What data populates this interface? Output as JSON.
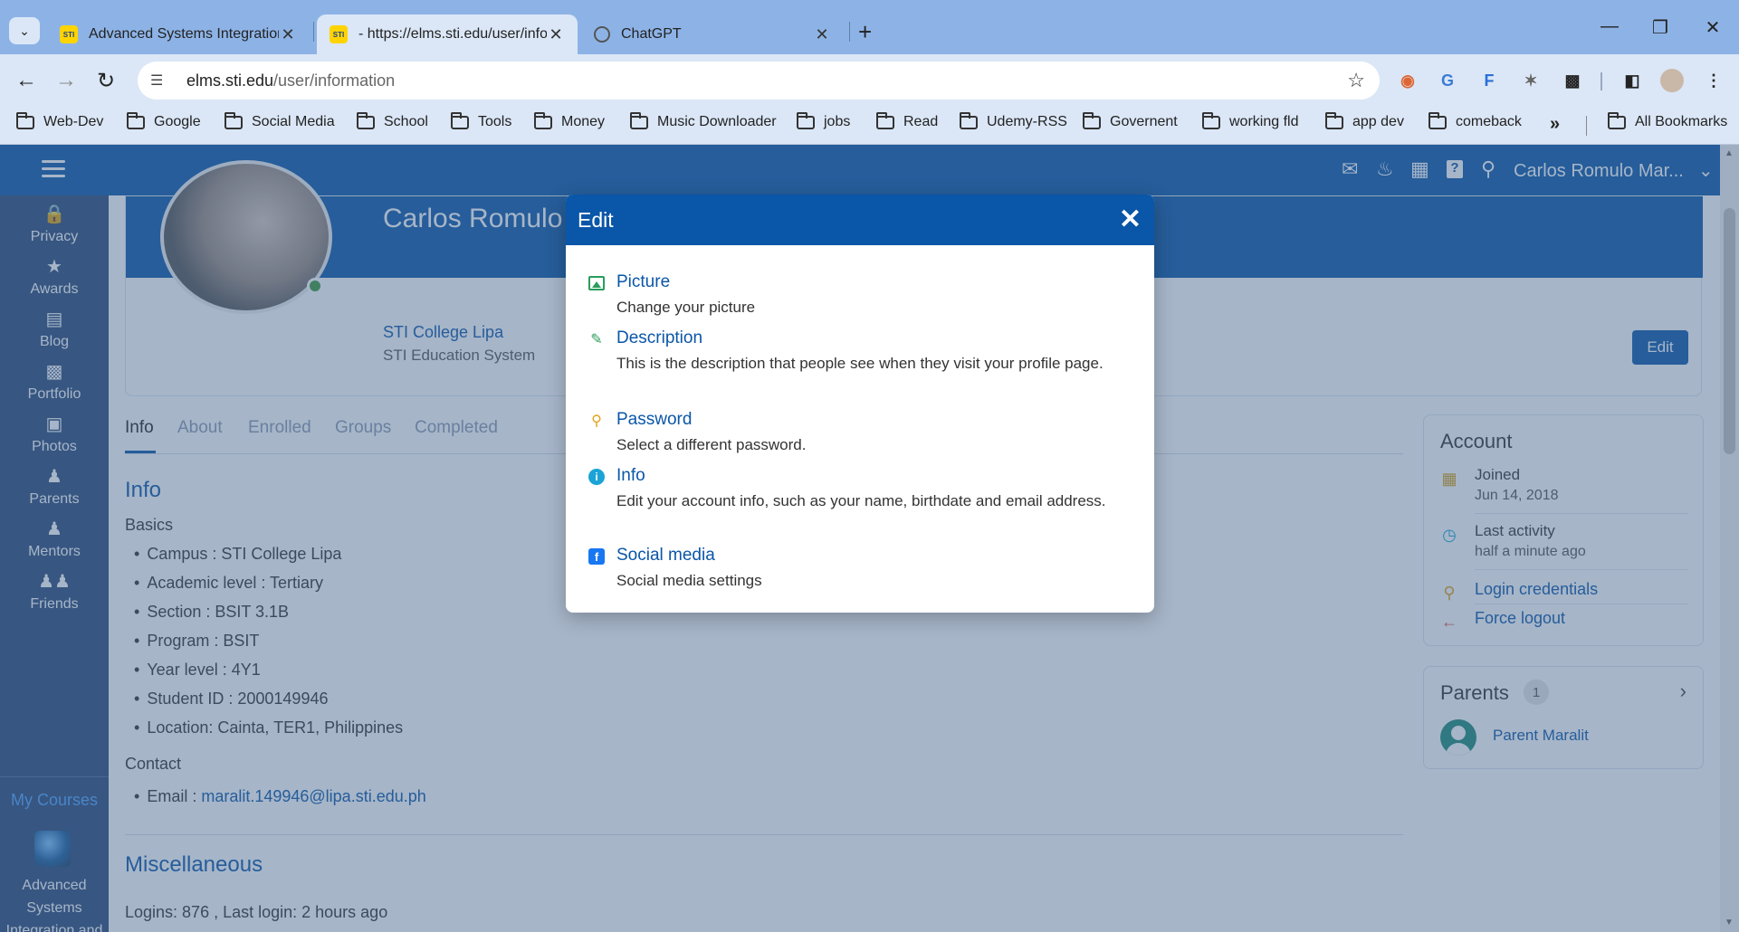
{
  "browser": {
    "tabs": [
      {
        "title": "Advanced Systems Integration",
        "favicon": "sti-icon",
        "active": false
      },
      {
        "title": "- https://elms.sti.edu/user/info",
        "favicon": "sti-icon",
        "active": true
      },
      {
        "title": "ChatGPT",
        "favicon": "chatgpt-icon",
        "active": false
      }
    ],
    "url_host": "elms.sti.edu",
    "url_path": "/user/information",
    "bookmarks": [
      "Web-Dev",
      "Google",
      "Social Media",
      "School",
      "Tools",
      "Money",
      "Music Downloader",
      "jobs",
      "Read",
      "Udemy-RSS",
      "Governent",
      "working fld",
      "app dev",
      "comeback"
    ],
    "all_bookmarks": "All Bookmarks"
  },
  "topnav": {
    "user_name": "Carlos Romulo Mar..."
  },
  "sidebar": {
    "items": [
      "Privacy",
      "Awards",
      "Blog",
      "Portfolio",
      "Photos",
      "Parents",
      "Mentors",
      "Friends"
    ],
    "my_courses": "My Courses",
    "course_name": "Advanced Systems Integration and Architecture -"
  },
  "profile": {
    "name": "Carlos Romulo M",
    "school": "STI College Lipa",
    "system": "STI Education System",
    "edit_label": "Edit"
  },
  "tabs": [
    "Info",
    "About",
    "Enrolled",
    "Groups",
    "Completed"
  ],
  "info": {
    "title": "Info",
    "basics_title": "Basics",
    "basics": [
      "Campus : STI College Lipa",
      "Academic level : Tertiary",
      "Section : BSIT 3.1B",
      "Program : BSIT",
      "Year level : 4Y1",
      "Student ID : 2000149946",
      "Location: Cainta, TER1, Philippines"
    ],
    "contact_title": "Contact",
    "email_label": "Email : ",
    "email": "maralit.149946@lipa.sti.edu.ph",
    "misc_title": "Miscellaneous",
    "logins": "Logins: 876 , Last login: 2 hours ago"
  },
  "account": {
    "title": "Account",
    "joined_label": "Joined",
    "joined_value": "Jun 14, 2018",
    "activity_label": "Last activity",
    "activity_value": "half a minute ago",
    "login_credentials": "Login credentials",
    "force_logout": "Force logout"
  },
  "parents": {
    "title": "Parents",
    "count": "1",
    "parent_name": "Parent Maralit"
  },
  "modal": {
    "title": "Edit",
    "items": [
      {
        "label": "Picture",
        "desc": "Change your picture",
        "icon": "picture-icon"
      },
      {
        "label": "Description",
        "desc": "This is the description that people see when they visit your profile page.",
        "icon": "pencil-icon"
      },
      {
        "label": "Password",
        "desc": "Select a different password.",
        "icon": "key-icon"
      },
      {
        "label": "Info",
        "desc": "Edit your account info, such as your name, birthdate and email address.",
        "icon": "info-icon"
      },
      {
        "label": "Social media",
        "desc": "Social media settings",
        "icon": "facebook-icon"
      }
    ]
  },
  "colors": {
    "primary": "#0a56a8",
    "sidebar": "#2b4a78",
    "tab_strip": "#8db3e6",
    "toolbar": "#dbe7f7"
  }
}
